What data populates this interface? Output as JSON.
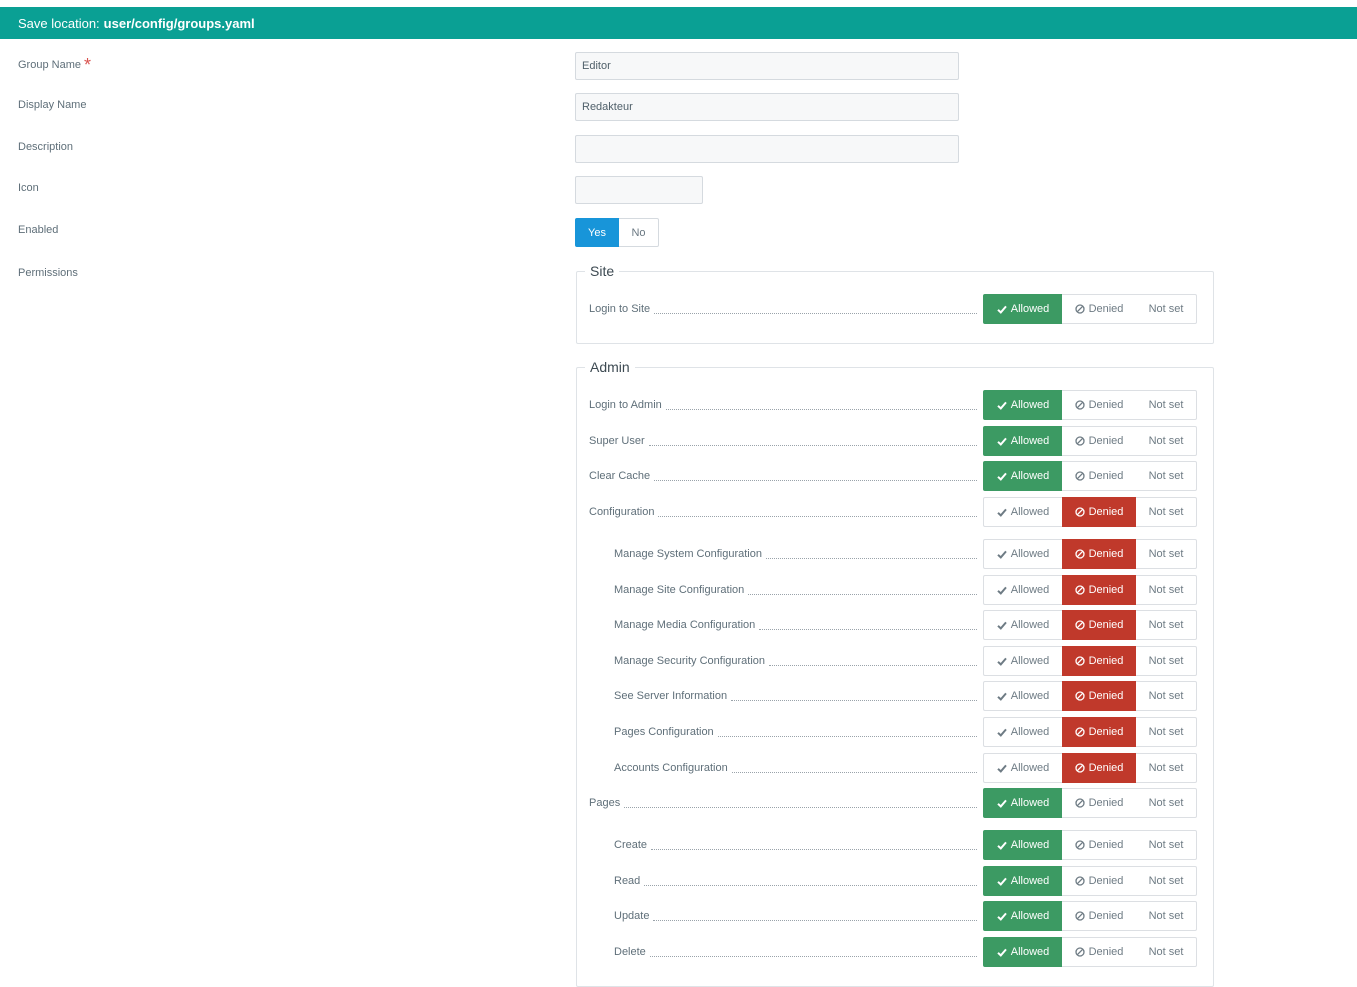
{
  "header": {
    "prefix": "Save location:",
    "path": "user/config/groups.yaml"
  },
  "form": {
    "group_name_label": "Group Name",
    "required_mark": "*",
    "group_name_value": "Editor",
    "display_name_label": "Display Name",
    "display_name_value": "Redakteur",
    "description_label": "Description",
    "description_value": "",
    "icon_label": "Icon",
    "icon_value": "",
    "enabled_label": "Enabled",
    "enabled_yes": "Yes",
    "enabled_no": "No",
    "enabled_selected": "Yes",
    "permissions_label": "Permissions"
  },
  "options": {
    "allowed": "Allowed",
    "denied": "Denied",
    "notset": "Not set"
  },
  "sections": {
    "site": {
      "title": "Site",
      "items": [
        {
          "label": "Login to Site",
          "state": "allowed",
          "indent": false
        }
      ]
    },
    "admin": {
      "title": "Admin",
      "items": [
        {
          "label": "Login to Admin",
          "state": "allowed",
          "indent": false
        },
        {
          "label": "Super User",
          "state": "allowed",
          "indent": false
        },
        {
          "label": "Clear Cache",
          "state": "allowed",
          "indent": false
        },
        {
          "label": "Configuration",
          "state": "denied",
          "indent": false
        },
        {
          "label": "Manage System Configuration",
          "state": "denied",
          "indent": true
        },
        {
          "label": "Manage Site Configuration",
          "state": "denied",
          "indent": true
        },
        {
          "label": "Manage Media Configuration",
          "state": "denied",
          "indent": true
        },
        {
          "label": "Manage Security Configuration",
          "state": "denied",
          "indent": true
        },
        {
          "label": "See Server Information",
          "state": "denied",
          "indent": true
        },
        {
          "label": "Pages Configuration",
          "state": "denied",
          "indent": true
        },
        {
          "label": "Accounts Configuration",
          "state": "denied",
          "indent": true
        },
        {
          "label": "Pages",
          "state": "allowed",
          "indent": false
        },
        {
          "label": "Create",
          "state": "allowed",
          "indent": true
        },
        {
          "label": "Read",
          "state": "allowed",
          "indent": true
        },
        {
          "label": "Update",
          "state": "allowed",
          "indent": true
        },
        {
          "label": "Delete",
          "state": "allowed",
          "indent": true
        }
      ]
    }
  },
  "icons": {
    "allowed": "check-icon",
    "denied": "ban-icon"
  },
  "colors": {
    "header": "#0aa094",
    "allowed": "#3c9a63",
    "denied": "#c0392b",
    "yes": "#1895d9"
  }
}
